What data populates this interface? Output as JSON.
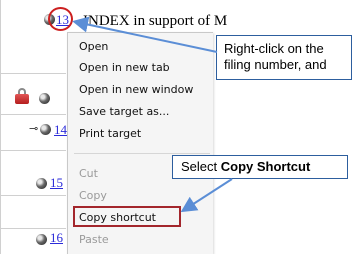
{
  "table": {
    "rows": [
      {
        "filing_number": "13",
        "has_lock": false,
        "has_key": false
      },
      {
        "filing_number": "",
        "has_lock": true,
        "has_key": false
      },
      {
        "filing_number": "14",
        "has_lock": false,
        "has_key": true
      },
      {
        "filing_number": "15",
        "has_lock": false,
        "has_key": false
      },
      {
        "filing_number": "16",
        "has_lock": false,
        "has_key": false
      }
    ],
    "document_title": "INDEX in support of M"
  },
  "context_menu": {
    "items": [
      {
        "label": "Open",
        "enabled": true
      },
      {
        "label": "Open in new tab",
        "enabled": true
      },
      {
        "label": "Open in new window",
        "enabled": true
      },
      {
        "label": "Save target as...",
        "enabled": true
      },
      {
        "label": "Print target",
        "enabled": true
      },
      {
        "label": "Cut",
        "enabled": false
      },
      {
        "label": "Copy",
        "enabled": false
      },
      {
        "label": "Copy shortcut",
        "enabled": true
      },
      {
        "label": "Paste",
        "enabled": false
      }
    ]
  },
  "callouts": {
    "right_click_line1": "Right-click on the",
    "right_click_line2": "filing number, and",
    "select_prefix": "Select ",
    "select_bold": "Copy Shortcut"
  },
  "colors": {
    "link": "#2b2bd9",
    "highlight_border": "#a3262c",
    "callout_border": "#2d5e9e",
    "arrow": "#5b8ed6"
  }
}
